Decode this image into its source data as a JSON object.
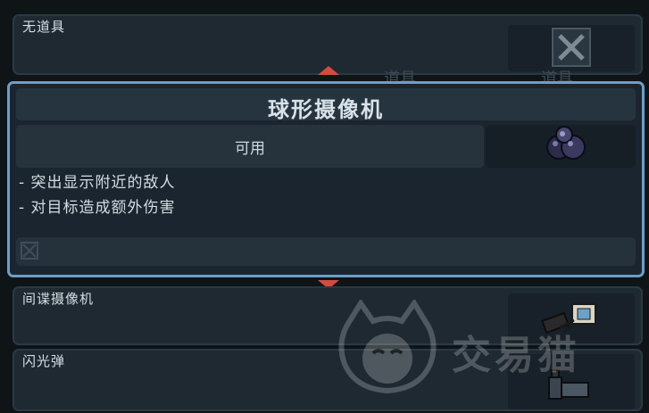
{
  "items": {
    "top": {
      "label": "无道具",
      "icon": "disabled-x-icon"
    },
    "spy": {
      "label": "间谍摄像机",
      "icon": "spy-camera-icon"
    },
    "flash": {
      "label": "闪光弹",
      "icon": "flashbang-icon"
    }
  },
  "detail": {
    "title": "球形摄像机",
    "status": "可用",
    "icon": "sphere-camera-icon",
    "descriptions": [
      "- 突出显示附近的敌人",
      "- 对目标造成额外伤害"
    ]
  },
  "background_tabs": [
    "道具",
    "道具"
  ],
  "watermark": {
    "text": "交易猫"
  },
  "colors": {
    "accent_border": "#6c9ec9",
    "arrow": "#d34c3f",
    "panel": "#1e2932",
    "background": "#0f1417"
  }
}
